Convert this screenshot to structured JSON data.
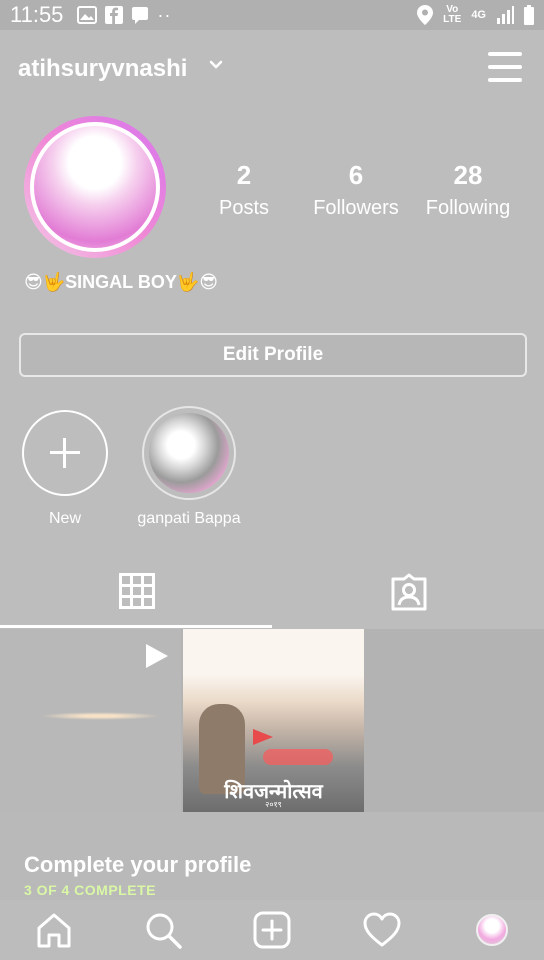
{
  "status_bar": {
    "time": "11:55",
    "left_icons": [
      "image-icon",
      "facebook-icon",
      "message-icon",
      "more-dots-icon"
    ],
    "dots": "··",
    "network_label": "LTE",
    "network_type": "4G",
    "right_icons": [
      "location-icon",
      "volte-icon",
      "data-icon",
      "signal-icon",
      "battery-icon"
    ]
  },
  "header": {
    "username": "atihsuryvnashi",
    "dropdown_icon": "chevron-down-icon",
    "menu_icon": "hamburger-menu-icon"
  },
  "profile": {
    "stats": [
      {
        "count": "2",
        "label": "Posts"
      },
      {
        "count": "6",
        "label": "Followers"
      },
      {
        "count": "28",
        "label": "Following"
      }
    ],
    "bio": "😎🤟SINGAL BOY🤟😎",
    "edit_button": "Edit Profile"
  },
  "highlights": [
    {
      "label": "New",
      "icon": "plus-icon"
    },
    {
      "label": "ganpati Bappa"
    }
  ],
  "tabs": {
    "active": "grid",
    "items": [
      "grid-icon",
      "tagged-user-icon"
    ]
  },
  "posts": [
    {
      "type": "video",
      "icon": "play-icon"
    },
    {
      "type": "image",
      "title": "शिवजन्मोत्सव",
      "subtitle": "२०१९"
    }
  ],
  "complete_profile": {
    "title": "Complete your profile",
    "subtitle": "3 OF 4 COMPLETE"
  },
  "bottom_nav": [
    "home-icon",
    "search-icon",
    "add-post-icon",
    "activity-heart-icon",
    "profile-avatar"
  ],
  "colors": {
    "background": "#bdbdbd",
    "text": "#ffffff",
    "avatar_ring": "#f088d6",
    "complete_accent": "#d9f7a5"
  }
}
